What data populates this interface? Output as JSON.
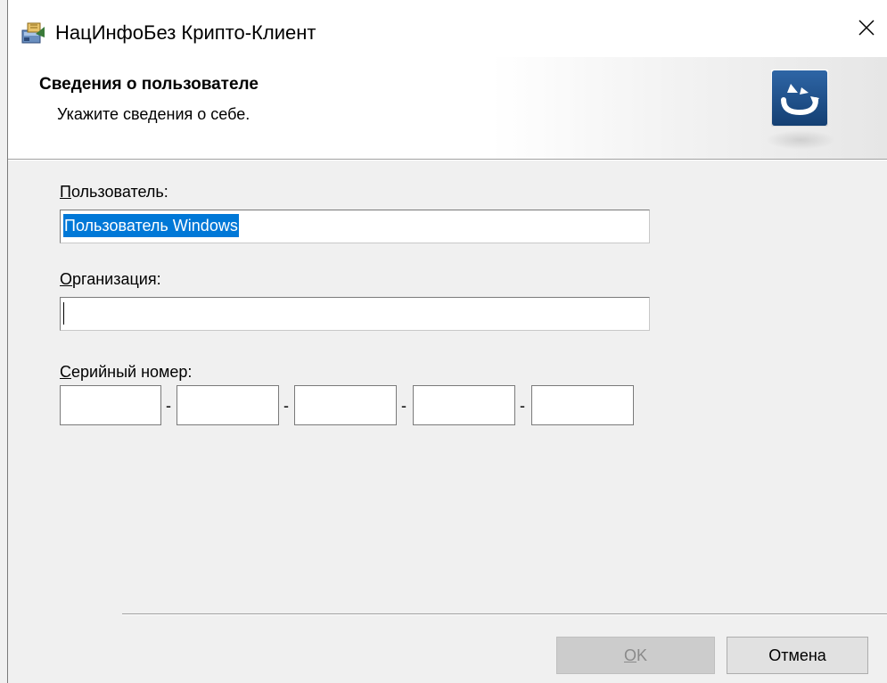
{
  "window": {
    "title": "НацИнфоБез Крипто-Клиент",
    "app_icon": "installer-package-icon",
    "close_icon": "close-icon"
  },
  "header": {
    "title": "Сведения о пользователе",
    "subtitle": "Укажите сведения о себе.",
    "logo_icon": "brand-logo-icon"
  },
  "form": {
    "user": {
      "label_access_key": "П",
      "label_rest": "ользователь:",
      "value": "Пользователь Windows"
    },
    "organization": {
      "label_access_key": "О",
      "label_rest": "рганизация:",
      "value": ""
    },
    "serial": {
      "label_access_key": "С",
      "label_rest": "ерийный номер:",
      "separator": "-",
      "segments": [
        "",
        "",
        "",
        "",
        ""
      ]
    }
  },
  "buttons": {
    "ok_access_key": "O",
    "ok_rest": "K",
    "ok_enabled": false,
    "cancel": "Отмена"
  },
  "colors": {
    "selection": "#0078d7",
    "logo_blue": "#1c4f8a"
  }
}
